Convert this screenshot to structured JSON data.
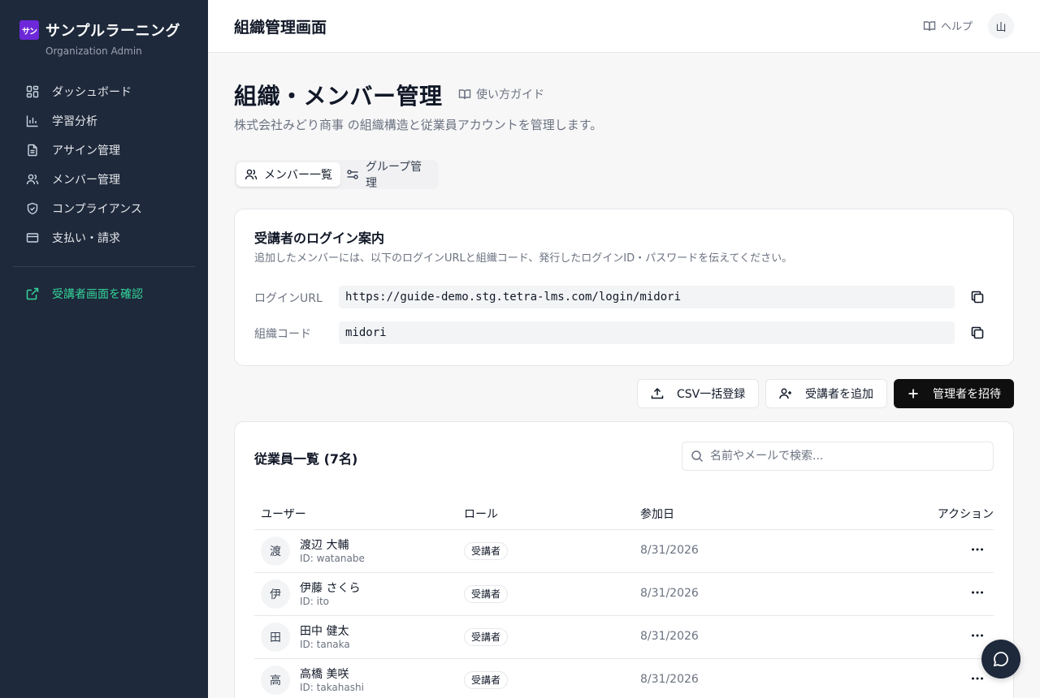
{
  "sidebar": {
    "logo_text": "サン",
    "app_name": "サンプルラーニング",
    "subtitle": "Organization Admin",
    "items": [
      {
        "label": "ダッシュボード",
        "icon": "dashboard-icon"
      },
      {
        "label": "学習分析",
        "icon": "bar-chart-icon"
      },
      {
        "label": "アサイン管理",
        "icon": "document-icon"
      },
      {
        "label": "メンバー管理",
        "icon": "users-icon"
      },
      {
        "label": "コンプライアンス",
        "icon": "shield-check-icon"
      },
      {
        "label": "支払い・請求",
        "icon": "credit-card-icon"
      }
    ],
    "learner_view_label": "受講者画面を確認",
    "accent_color": "#34d399"
  },
  "header": {
    "title": "組織管理画面",
    "help_label": "ヘルプ",
    "avatar_initial": "山"
  },
  "page": {
    "title": "組織・メンバー管理",
    "guide_label": "使い方ガイド",
    "description": "株式会社みどり商事 の組織構造と従業員アカウントを管理します。"
  },
  "tabs": [
    {
      "label": "メンバー一覧",
      "active": true
    },
    {
      "label": "グループ管理",
      "active": false
    }
  ],
  "login_card": {
    "title": "受講者のログイン案内",
    "description": "追加したメンバーには、以下のログインURLと組織コード、発行したログインID・パスワードを伝えてください。",
    "url_label": "ログインURL",
    "url_value": "https://guide-demo.stg.tetra-lms.com/login/midori",
    "code_label": "組織コード",
    "code_value": "midori"
  },
  "actions": {
    "csv_label": "CSV一括登録",
    "add_learner_label": "受講者を追加",
    "invite_admin_label": "管理者を招待"
  },
  "employee_list": {
    "title": "従業員一覧 (7名)",
    "search_placeholder": "名前やメールで検索...",
    "columns": [
      "ユーザー",
      "ロール",
      "参加日",
      "アクション"
    ],
    "rows": [
      {
        "initial": "渡",
        "name": "渡辺 大輔",
        "id": "ID: watanabe",
        "role": "受講者",
        "joined": "8/31/2026"
      },
      {
        "initial": "伊",
        "name": "伊藤 さくら",
        "id": "ID: ito",
        "role": "受講者",
        "joined": "8/31/2026"
      },
      {
        "initial": "田",
        "name": "田中 健太",
        "id": "ID: tanaka",
        "role": "受講者",
        "joined": "8/31/2026"
      },
      {
        "initial": "高",
        "name": "高橋 美咲",
        "id": "ID: takahashi",
        "role": "受講者",
        "joined": "8/31/2026"
      }
    ]
  }
}
